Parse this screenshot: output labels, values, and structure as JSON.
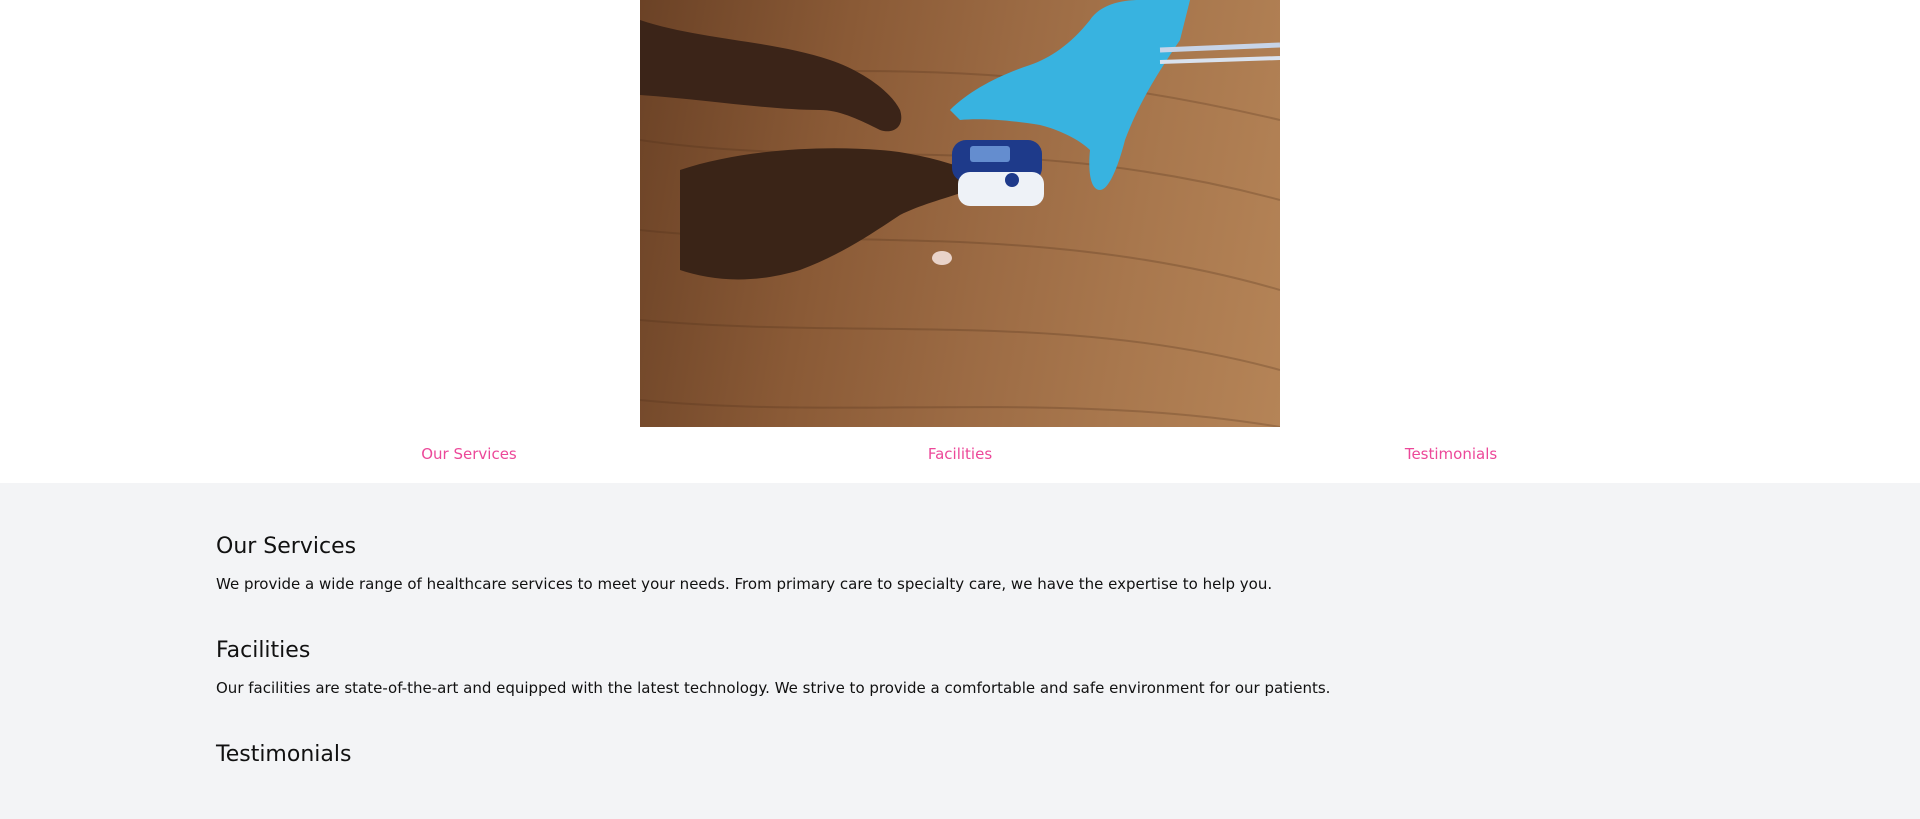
{
  "hero": {
    "image_alt": "Pulse oximeter being placed on a patient's finger by a gloved hand"
  },
  "nav": {
    "items": [
      {
        "label": "Our Services"
      },
      {
        "label": "Facilities"
      },
      {
        "label": "Testimonials"
      }
    ]
  },
  "sections": [
    {
      "heading": "Our Services",
      "body": "We provide a wide range of healthcare services to meet your needs. From primary care to specialty care, we have the expertise to help you."
    },
    {
      "heading": "Facilities",
      "body": "Our facilities are state-of-the-art and equipped with the latest technology. We strive to provide a comfortable and safe environment for our patients."
    },
    {
      "heading": "Testimonials",
      "body": ""
    }
  ],
  "colors": {
    "accent": "#ec4899",
    "section_bg": "#f3f4f6",
    "text": "#111111"
  }
}
